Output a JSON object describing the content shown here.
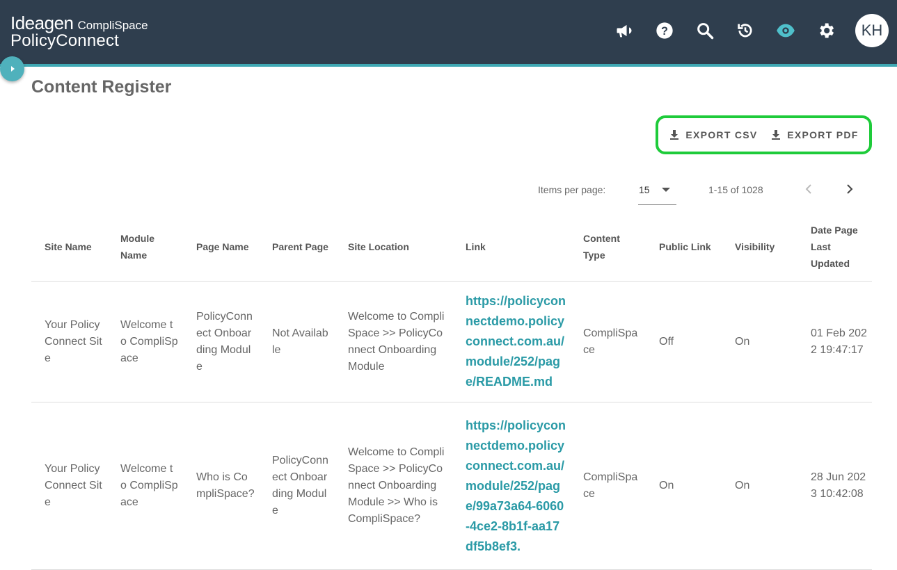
{
  "header": {
    "brand_company": "Ideagen",
    "brand_sub": "CompliSpace",
    "brand_product": "PolicyConnect",
    "avatar_initials": "KH",
    "icons": [
      "megaphone-icon",
      "help-icon",
      "search-icon",
      "history-icon",
      "eye-icon",
      "gear-icon"
    ]
  },
  "page": {
    "title": "Content Register"
  },
  "export": {
    "csv_label": "EXPORT CSV",
    "pdf_label": "EXPORT PDF"
  },
  "pager": {
    "items_per_page_label": "Items per page:",
    "items_per_page_value": "15",
    "range": "1-15 of 1028"
  },
  "table": {
    "headers": [
      "Site Name",
      "Module Name",
      "Page Name",
      "Parent Page",
      "Site Location",
      "Link",
      "Content Type",
      "Public Link",
      "Visibility",
      "Date Page Last Updated"
    ],
    "rows": [
      [
        "Your PolicyConnect Site",
        "Welcome to CompliSpace",
        "PolicyConnect Onboarding Module",
        "Not Available",
        "Welcome to CompliSpace >> PolicyConnect Onboarding Module",
        "https://policyconnectdemo.policyconnect.com.au/module/252/page/README.md",
        "CompliSpace",
        "Off",
        "On",
        "01 Feb 2022 19:47:17"
      ],
      [
        "Your PolicyConnect Site",
        "Welcome to CompliSpace",
        "Who is CompliSpace?",
        "PolicyConnect Onboarding Module",
        "Welcome to CompliSpace >> PolicyConnect Onboarding Module >> Who is CompliSpace?",
        "https://policyconnectdemo.policyconnect.com.au/module/252/page/99a73a64-6060-4ce2-8b1f-aa17df5b8ef3.",
        "CompliSpace",
        "On",
        "On",
        "28 Jun 2023 10:42:08"
      ]
    ]
  },
  "colors": {
    "header_bg": "#2f3e4e",
    "accent": "#3fa8b3",
    "link": "#2a9aa6",
    "highlight": "#1ecb3a"
  }
}
